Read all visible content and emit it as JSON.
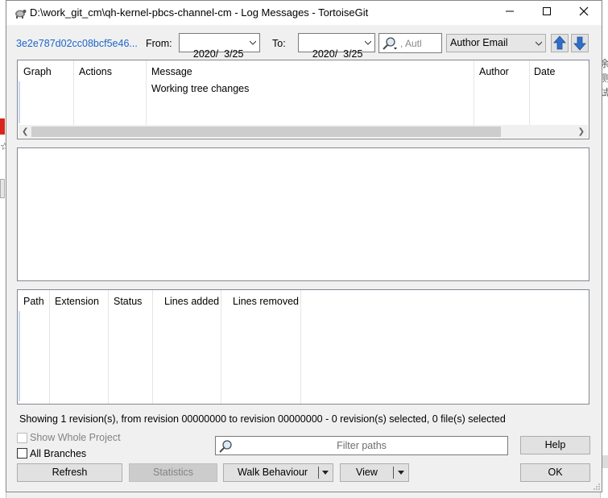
{
  "window": {
    "title": "D:\\work_git_cm\\qh-kernel-pbcs-channel-cm - Log Messages - TortoiseGit",
    "minimize": "—",
    "maximize": "☐",
    "close": "✕"
  },
  "toolbar": {
    "revision_link": "3e2e787d02cc08bcf5e46...",
    "from_label": "From:",
    "from_date": "2020/  3/25",
    "to_label": "To:",
    "to_date": "2020/  3/25",
    "search_text": ", Autl",
    "filter_field": "Author Email"
  },
  "log_table": {
    "columns": [
      "Graph",
      "Actions",
      "Message",
      "Author",
      "Date"
    ],
    "rows": [
      {
        "graph": "",
        "actions": "",
        "message": "Working tree changes",
        "author": "",
        "date": ""
      }
    ]
  },
  "files_table": {
    "columns": [
      "Path",
      "Extension",
      "Status",
      "Lines added",
      "Lines removed"
    ]
  },
  "status_text": "Showing 1 revision(s), from revision 00000000 to revision 00000000 - 0 revision(s) selected, 0 file(s) selected",
  "options": {
    "show_whole_project": "Show Whole Project",
    "all_branches": "All Branches"
  },
  "filter_paths_placeholder": "Filter paths",
  "buttons": {
    "help": "Help",
    "refresh": "Refresh",
    "statistics": "Statistics",
    "walk_behaviour": "Walk Behaviour",
    "view": "View",
    "ok": "OK"
  },
  "background": {
    "right_text": "余\n测\n试"
  },
  "colors": {
    "link": "#1b66c9",
    "arrow_blue": "#2f6fc9",
    "window_bg": "#f0f0f0"
  }
}
